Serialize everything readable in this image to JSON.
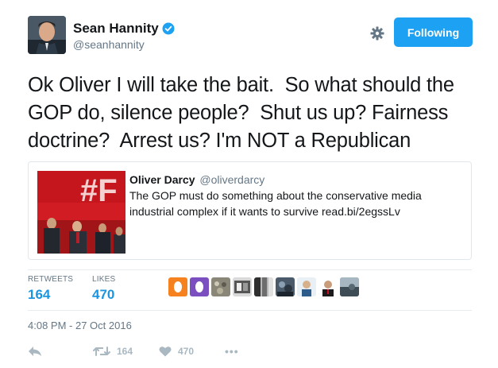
{
  "author": {
    "display_name": "Sean Hannity",
    "handle": "@seanhannity",
    "follow_label": "Following",
    "verified_icon": "verified-badge-icon"
  },
  "tweet": {
    "text": "Ok Oliver I will take the bait.  So what should the GOP do, silence people?  Shut us up? Fairness doctrine?  Arrest us? I'm NOT a Republican",
    "timestamp": "4:08 PM - 27 Oct 2016"
  },
  "quoted": {
    "display_name": "Oliver Darcy",
    "handle": "@oliverdarcy",
    "text": "The GOP must do something about the conservative media industrial complex if it wants to survive read.bi/2egssLv"
  },
  "stats": {
    "retweets_label": "RETWEETS",
    "retweets_value": "164",
    "likes_label": "LIKES",
    "likes_value": "470"
  },
  "actions": {
    "retweet_count": "164",
    "like_count": "470",
    "more_label": "•••"
  },
  "colors": {
    "accent": "#1da1f2",
    "stat_blue": "#1b95e0",
    "muted": "#657786"
  }
}
